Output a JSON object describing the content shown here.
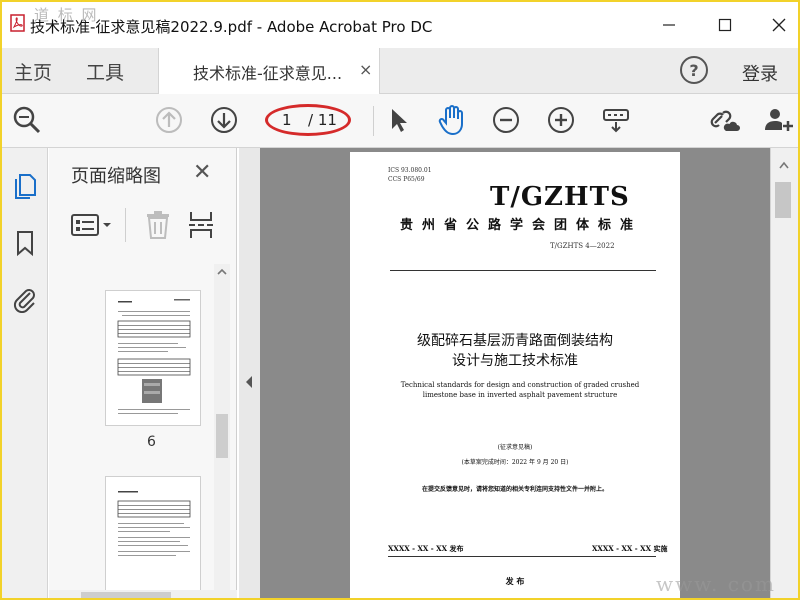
{
  "window": {
    "title": "技术标准-征求意见稿2022.9.pdf - Adobe Acrobat Pro DC",
    "watermark_top": "道 标 网",
    "watermark_bottom": "www.   com",
    "minimize_icon": "minimize-icon",
    "maximize_icon": "maximize-icon",
    "close_icon": "close-icon"
  },
  "tabs": {
    "home": "主页",
    "tools": "工具",
    "document": "技术标准-征求意见...",
    "close_glyph": "×",
    "help_glyph": "?",
    "login": "登录"
  },
  "toolbar": {
    "current_page": "1",
    "total_pages": "/ 11"
  },
  "thumbnails": {
    "title": "页面缩略图",
    "close_glyph": "✕",
    "items": [
      {
        "label": "6"
      },
      {
        "label": ""
      }
    ]
  },
  "document_page": {
    "ics": "ICS  93.080.01",
    "ccs": "CCS  P65/69",
    "logo": "T/GZHTS",
    "org": "贵州省公路学会团体标准",
    "code": "T/GZHTS  4—2022",
    "title_line1": "级配碎石基层沥青路面倒装结构",
    "title_line2": "设计与施工技术标准",
    "english_title": "Technical standards for design and construction of graded crushed limestone base in inverted asphalt pavement structure",
    "draft": "(征求意见稿)",
    "draft_date": "(本草案完成时间：2022 年 9 月 20 日)",
    "note": "在提交反馈意见时，请将您知道的相关专利连同支持性文件一并附上。",
    "publish_left": "XXXX - XX - XX 发布",
    "publish_right": "XXXX - XX - XX 实施",
    "issuer": "发 布"
  }
}
